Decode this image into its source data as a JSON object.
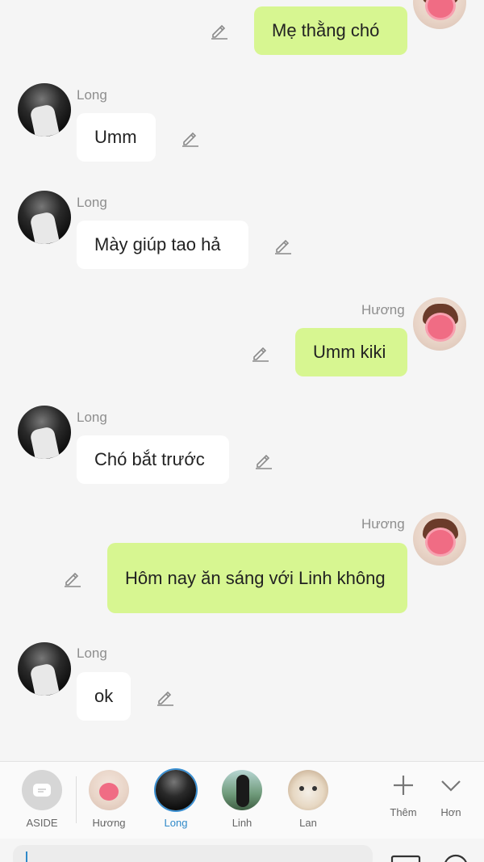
{
  "messages": [
    {
      "sender": "",
      "text": "Mẹ thằng chó",
      "dir": "out"
    },
    {
      "sender": "Long",
      "text": "Umm",
      "dir": "in"
    },
    {
      "sender": "Long",
      "text": "Mày giúp tao hả",
      "dir": "in"
    },
    {
      "sender": "Hương",
      "text": "Umm kiki",
      "dir": "out"
    },
    {
      "sender": "Long",
      "text": "Chó bắt trước",
      "dir": "in"
    },
    {
      "sender": "Hương",
      "text": "Hôm nay ăn sáng với Linh không",
      "dir": "out"
    },
    {
      "sender": "Long",
      "text": "ok",
      "dir": "in"
    }
  ],
  "tabbar": {
    "aside": "ASIDE",
    "contacts": [
      {
        "label": "Hương"
      },
      {
        "label": "Long",
        "active": true
      },
      {
        "label": "Linh"
      },
      {
        "label": "Lan"
      }
    ],
    "add_label": "Thêm",
    "more_label": "Hơn"
  },
  "colors": {
    "incoming_bubble": "#ffffff",
    "outgoing_bubble": "#d7f691",
    "active_tab": "#2f89c9",
    "background": "#f5f5f5"
  },
  "icons": {
    "edit": "pencil-icon",
    "add": "plus-icon",
    "more": "chevron-down-icon",
    "aside": "chat-bubble-icon"
  }
}
